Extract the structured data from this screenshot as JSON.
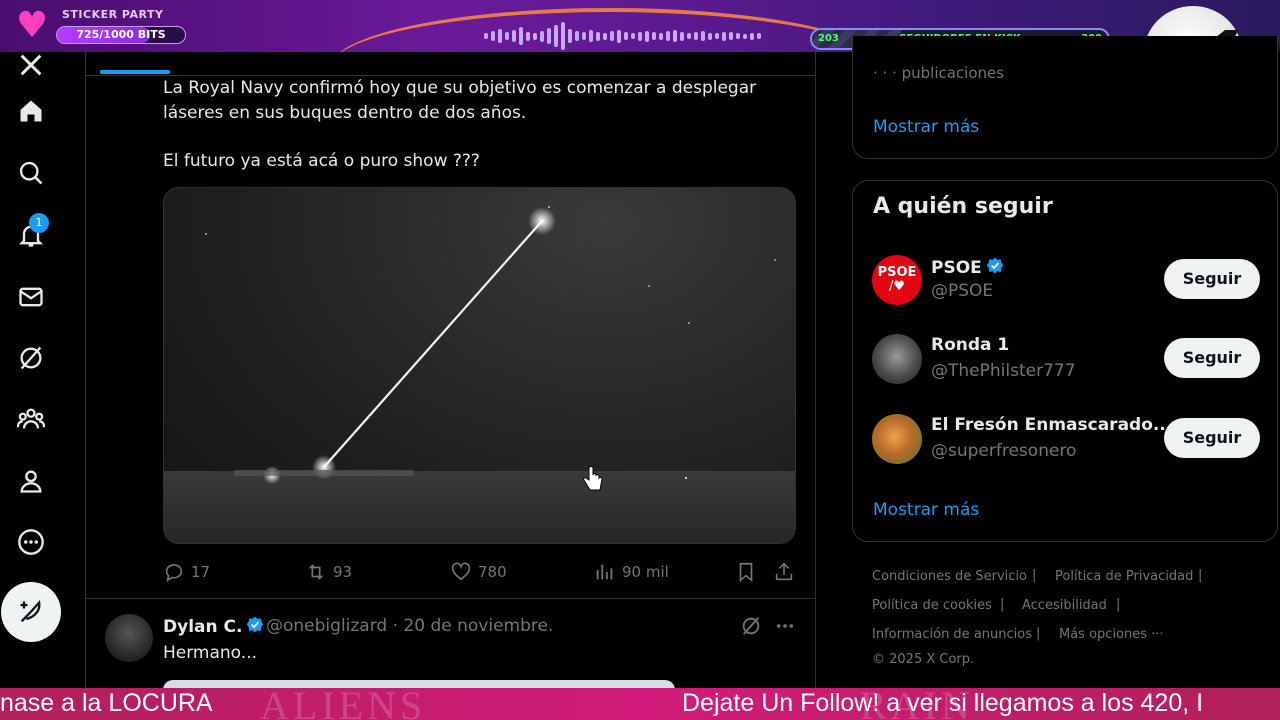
{
  "overlay": {
    "sticker_title": "STICKER PARTY",
    "sticker_progress": "725/1000 BITS",
    "sticker_fraction": 0.725,
    "follow_goal_current": "203",
    "follow_goal_label": "SEGUIDORES EN KICK",
    "follow_goal_target": "300",
    "follow_fraction": 0.3
  },
  "nav": {
    "notifications_count": "1",
    "items": [
      "x-logo-icon",
      "home-icon",
      "search-icon",
      "notifications-icon",
      "messages-icon",
      "grok-icon",
      "communities-icon",
      "profile-icon",
      "more-icon",
      "post-icon"
    ]
  },
  "post": {
    "line1": "La Royal Navy confirmó hoy que su objetivo es comenzar a desplegar",
    "line2": "láseres en sus buques dentro de dos años.",
    "line3": "El futuro ya está acá o puro show ???",
    "replies": "17",
    "reposts": "93",
    "likes": "780",
    "views": "90 mil"
  },
  "reply": {
    "name": "Dylan C.",
    "handle": "@onebiglizard",
    "date": "· 20 de noviembre.",
    "text": "Hermano..."
  },
  "sidebar": {
    "top_partial": "· · · publicaciones",
    "show_more_top": "Mostrar más",
    "who_to_follow_title": "A quién seguir",
    "follow_suggestions": [
      {
        "name": "PSOE",
        "handle": "@PSOE",
        "button": "Seguir",
        "verified": true,
        "avatar_text": "PSOE"
      },
      {
        "name": "Ronda 1",
        "handle": "@ThePhilster777",
        "button": "Seguir",
        "verified": false
      },
      {
        "name": "El Fresón Enmascarado...",
        "handle": "@superfresonero",
        "button": "Seguir",
        "verified": false
      }
    ],
    "show_more_bottom": "Mostrar más"
  },
  "footer": {
    "terms": "Condiciones de Servicio",
    "privacy": "Política de Privacidad",
    "cookies": "Política de cookies",
    "accessibility": "Accesibilidad",
    "ads_info": "Información de anuncios",
    "more_options": "Más opciones ···",
    "copyright": "© 2025 X Corp."
  },
  "ticker": {
    "left_text": "nase a la LOCURA",
    "right_text": "Dejate Un Follow!  a ver si llegamos a los 420, I",
    "ghost_left": "ALIENS",
    "ghost_right": "RAIN"
  },
  "colors": {
    "accent": "#1d9bf0",
    "ticker": "#d21b7a",
    "overlay_purple": "#6a1a9a"
  }
}
